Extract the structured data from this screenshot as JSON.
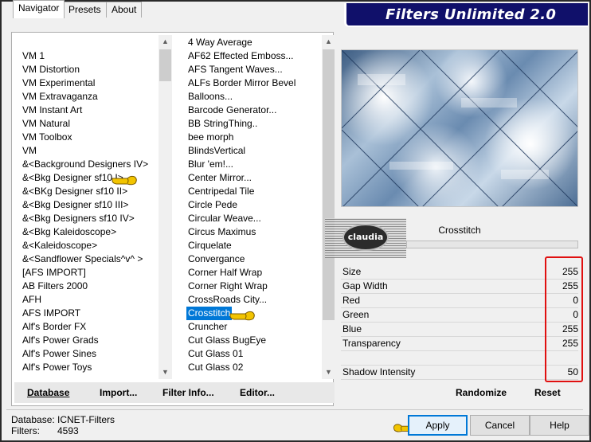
{
  "banner": {
    "title": "Filters Unlimited 2.0"
  },
  "tabs": [
    "Navigator",
    "Presets",
    "About"
  ],
  "categories": [
    "VM 1",
    "VM Distortion",
    "VM Experimental",
    "VM Extravaganza",
    "VM Instant Art",
    "VM Natural",
    "VM Toolbox",
    "VM",
    "&<Background Designers IV>",
    "&<Bkg Designer sf10 I>",
    "&<BKg Designer sf10 II>",
    "&<Bkg Designer sf10 III>",
    "&<Bkg Designers sf10 IV>",
    "&<Bkg Kaleidoscope>",
    "&<Kaleidoscope>",
    "&<Sandflower Specials^v^ >",
    "[AFS IMPORT]",
    "AB Filters 2000",
    "AFH",
    "AFS IMPORT",
    "Alf's Border FX",
    "Alf's Power Grads",
    "Alf's Power Sines",
    "Alf's Power Toys"
  ],
  "filters": [
    "4 Way Average",
    "AF62 Effected Emboss...",
    "AFS Tangent Waves...",
    "ALFs Border Mirror Bevel",
    "Balloons...",
    "Barcode Generator...",
    "BB StringThing..",
    "bee morph",
    "BlindsVertical",
    "Blur 'em!...",
    "Center Mirror...",
    "Centripedal Tile",
    "Circle Pede",
    "Circular Weave...",
    "Circus Maximus",
    "Cirquelate",
    "Convergance",
    "Corner Half Wrap",
    "Corner Right Wrap",
    "CrossRoads City...",
    "Crosstitch",
    "Cruncher",
    "Cut Glass  BugEye",
    "Cut Glass 01",
    "Cut Glass 02"
  ],
  "selected_filter_index": 20,
  "nav_buttons": {
    "database": "Database",
    "import": "Import...",
    "filter_info": "Filter Info...",
    "editor": "Editor..."
  },
  "preview": {
    "filter_name": "Crosstitch",
    "watermark_text": "claudia"
  },
  "params": [
    {
      "label": "Size",
      "value": "255"
    },
    {
      "label": "Gap Width",
      "value": "255"
    },
    {
      "label": "Red",
      "value": "0"
    },
    {
      "label": "Green",
      "value": "0"
    },
    {
      "label": "Blue",
      "value": "255"
    },
    {
      "label": "Transparency",
      "value": "255"
    },
    {
      "label": "",
      "value": ""
    },
    {
      "label": "Shadow Intensity",
      "value": "50"
    }
  ],
  "param_buttons": {
    "randomize": "Randomize",
    "reset": "Reset"
  },
  "footer": {
    "database_label": "Database:",
    "database_value": "ICNET-Filters",
    "filters_label": "Filters:",
    "filters_value": "4593"
  },
  "dialog_buttons": {
    "apply": "Apply",
    "cancel": "Cancel",
    "help": "Help"
  },
  "colors": {
    "selection": "#0078d7",
    "banner": "#10106a",
    "highlight_box": "#e01010",
    "pointer_hand": "#f2c400"
  }
}
